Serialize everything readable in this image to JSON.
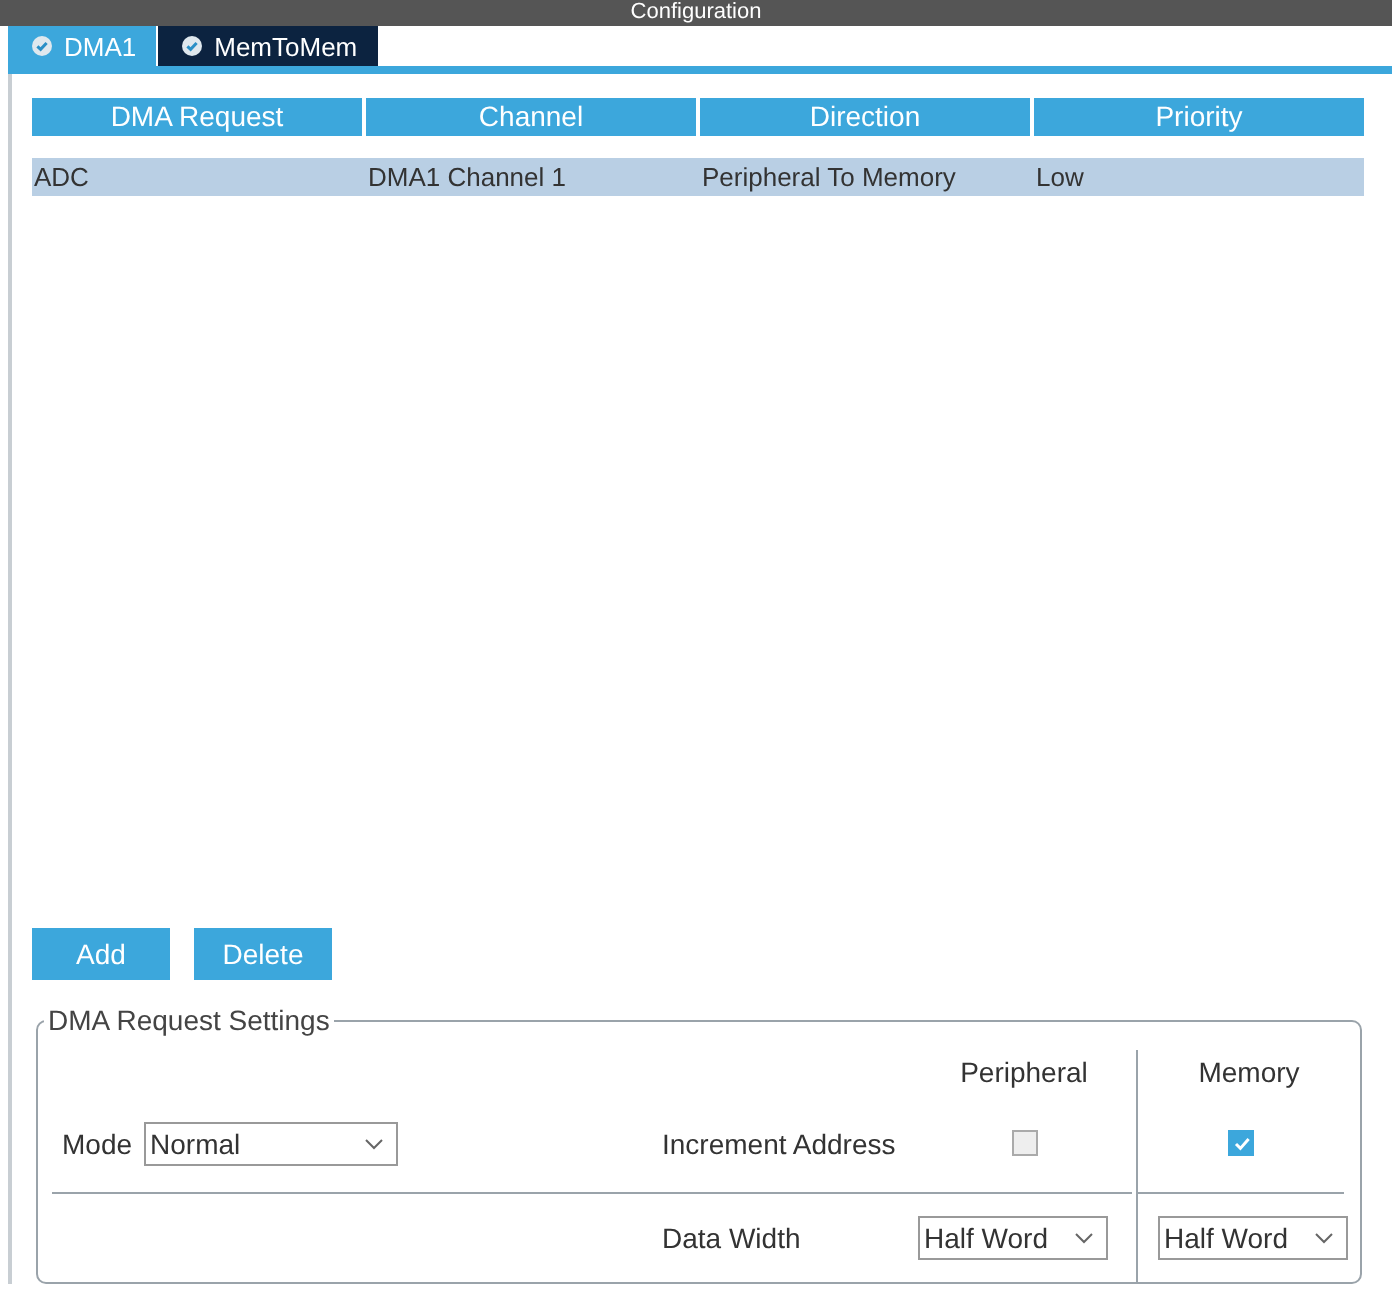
{
  "window": {
    "title": "Configuration"
  },
  "tabs": [
    {
      "label": "DMA1",
      "selected": true
    },
    {
      "label": "MemToMem",
      "selected": false
    }
  ],
  "table": {
    "columns": [
      "DMA Request",
      "Channel",
      "Direction",
      "Priority"
    ],
    "rows": [
      {
        "cells": [
          "ADC",
          "DMA1 Channel 1",
          "Peripheral To Memory",
          "Low"
        ],
        "selected": true
      }
    ]
  },
  "buttons": [
    "Add",
    "Delete"
  ],
  "settings": {
    "title": "DMA Request Settings",
    "mode_label": "Mode",
    "mode_value": "Normal",
    "peripheral_header": "Peripheral",
    "memory_header": "Memory",
    "increment_label": "Increment Address",
    "peripheral_increment": false,
    "memory_increment": true,
    "data_width_label": "Data Width",
    "peripheral_width": "Half Word",
    "memory_width": "Half Word"
  }
}
